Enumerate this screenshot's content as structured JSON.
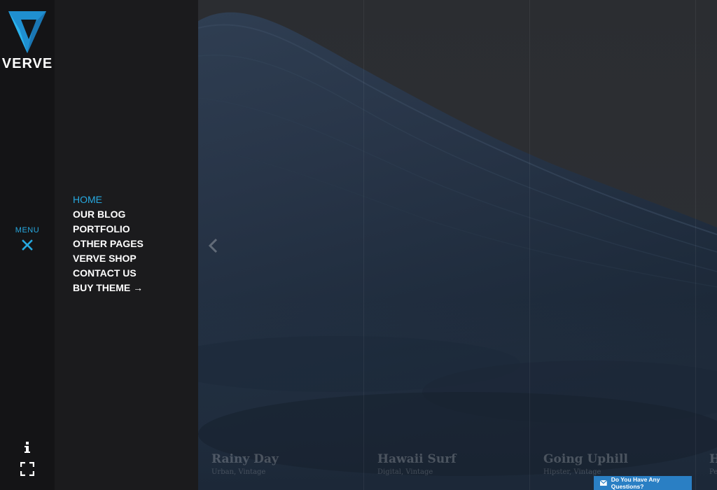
{
  "brand": {
    "name": "VERVE"
  },
  "rail": {
    "menu_label": "MENU"
  },
  "nav": {
    "items": [
      {
        "label": "HOME",
        "active": true
      },
      {
        "label": "OUR BLOG"
      },
      {
        "label": "PORTFOLIO"
      },
      {
        "label": "OTHER PAGES"
      },
      {
        "label": "VERVE SHOP"
      },
      {
        "label": "CONTACT US"
      },
      {
        "label": "BUY THEME →"
      }
    ]
  },
  "portfolio": {
    "items": [
      {
        "title": "Rainy Day",
        "tags": "Urban, Vintage"
      },
      {
        "title": "Hawaii Surf",
        "tags": "Digital, Vintage"
      },
      {
        "title": "Going Uphill",
        "tags": "Hipster, Vintage"
      },
      {
        "title": "H",
        "tags": "Pe"
      }
    ]
  },
  "widget": {
    "questions_label": "Do You Have Any Questions?"
  },
  "colors": {
    "accent": "#27a9e0",
    "rail_bg": "#141416",
    "panel_bg": "#1b1b1d",
    "widget_bg": "#2a7fc4"
  },
  "icons": [
    "verve-logo-icon",
    "close-icon",
    "info-icon",
    "fullscreen-icon",
    "chevron-left-icon",
    "envelope-icon"
  ]
}
